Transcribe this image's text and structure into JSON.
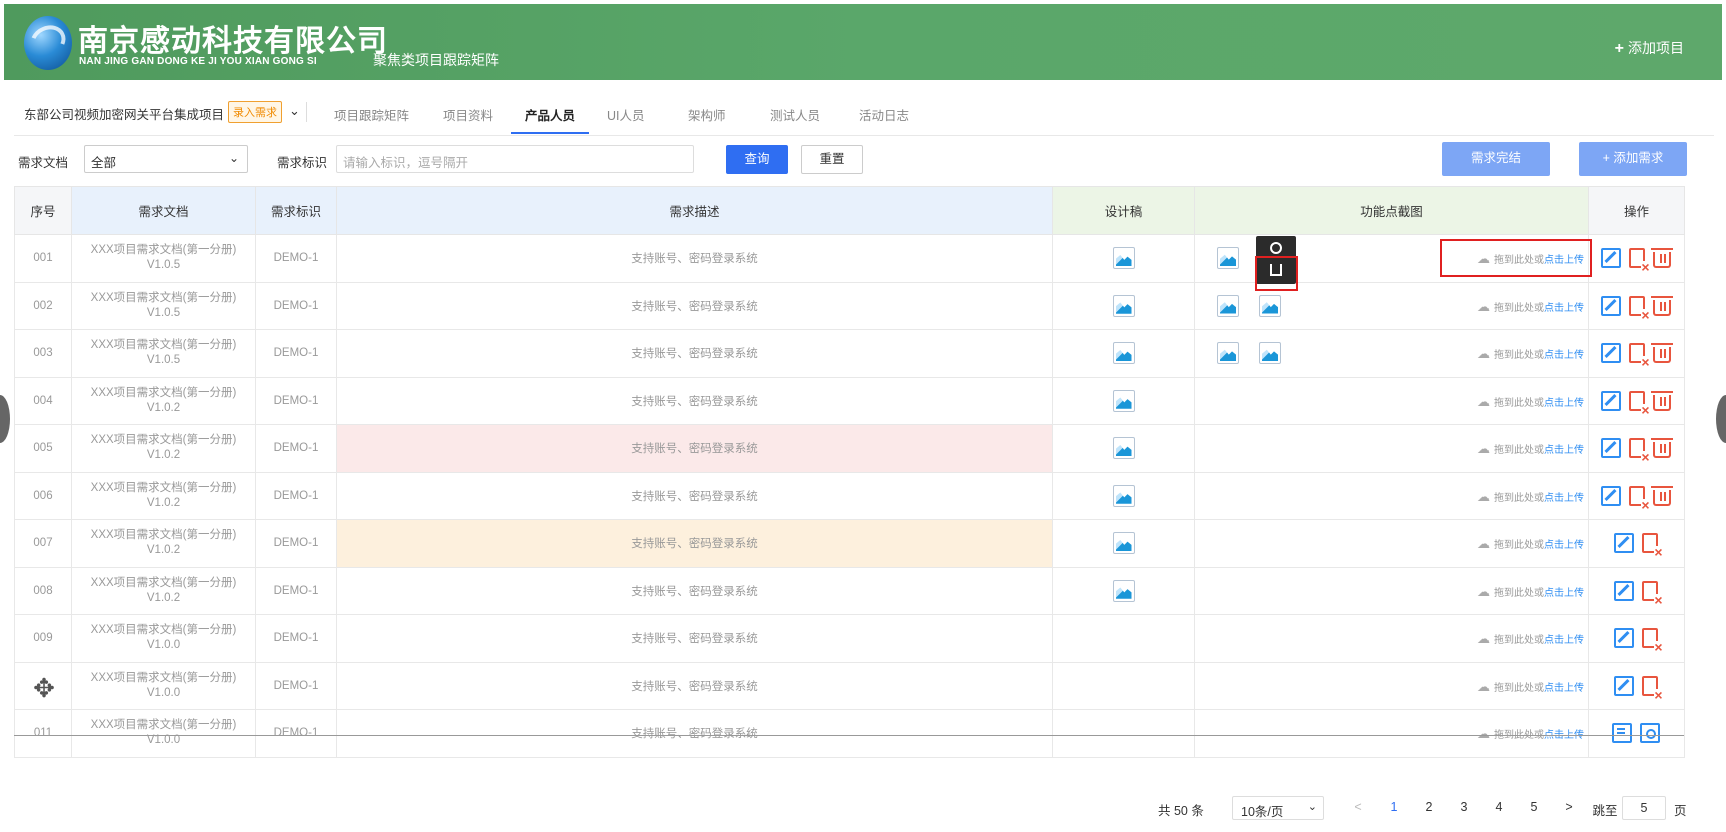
{
  "header": {
    "company_cn": "南京感动科技有限公司",
    "company_en": "NAN JING GAN DONG KE JI YOU XIAN GONG SI",
    "subtitle": "聚焦类项目跟踪矩阵",
    "add_project": "添加项目",
    "bg_color": "#5aa76a"
  },
  "nav": {
    "project_title": "东部公司视频加密网关平台集成项目",
    "tag": "录入需求",
    "tabs": [
      {
        "label": "项目跟踪矩阵"
      },
      {
        "label": "项目资料"
      },
      {
        "label": "产品人员"
      },
      {
        "label": "UI人员"
      },
      {
        "label": "架构师"
      },
      {
        "label": "测试人员"
      },
      {
        "label": "活动日志"
      }
    ],
    "active_tab": "产品人员"
  },
  "filter": {
    "doc_label": "需求文档",
    "doc_value": "全部",
    "id_label": "需求标识",
    "id_placeholder": "请输入标识，逗号隔开",
    "query": "查询",
    "reset": "重置",
    "complete": "需求完结",
    "add": "+ 添加需求"
  },
  "table": {
    "headers": {
      "seq": "序号",
      "doc": "需求文档",
      "id": "需求标识",
      "desc": "需求描述",
      "design": "设计稿",
      "func": "功能点截图",
      "ops": "操作"
    },
    "upload_text": "拖到此处或",
    "upload_link": "点击上传",
    "rows": [
      {
        "seq": "001",
        "doc1": "XXX项目需求文档(第一分册)",
        "doc2": "V1.0.5",
        "id": "DEMO-1",
        "desc": "支持账号、密码登录系统"
      },
      {
        "seq": "002",
        "doc1": "XXX项目需求文档(第一分册)",
        "doc2": "V1.0.5",
        "id": "DEMO-1",
        "desc": "支持账号、密码登录系统"
      },
      {
        "seq": "003",
        "doc1": "XXX项目需求文档(第一分册)",
        "doc2": "V1.0.5",
        "id": "DEMO-1",
        "desc": "支持账号、密码登录系统"
      },
      {
        "seq": "004",
        "doc1": "XXX项目需求文档(第一分册)",
        "doc2": "V1.0.2",
        "id": "DEMO-1",
        "desc": "支持账号、密码登录系统"
      },
      {
        "seq": "005",
        "doc1": "XXX项目需求文档(第一分册)",
        "doc2": "V1.0.2",
        "id": "DEMO-1",
        "desc": "支持账号、密码登录系统"
      },
      {
        "seq": "006",
        "doc1": "XXX项目需求文档(第一分册)",
        "doc2": "V1.0.2",
        "id": "DEMO-1",
        "desc": "支持账号、密码登录系统"
      },
      {
        "seq": "007",
        "doc1": "XXX项目需求文档(第一分册)",
        "doc2": "V1.0.2",
        "id": "DEMO-1",
        "desc": "支持账号、密码登录系统"
      },
      {
        "seq": "008",
        "doc1": "XXX项目需求文档(第一分册)",
        "doc2": "V1.0.2",
        "id": "DEMO-1",
        "desc": "支持账号、密码登录系统"
      },
      {
        "seq": "009",
        "doc1": "XXX项目需求文档(第一分册)",
        "doc2": "V1.0.0",
        "id": "DEMO-1",
        "desc": "支持账号、密码登录系统"
      },
      {
        "seq": "",
        "doc1": "XXX项目需求文档(第一分册)",
        "doc2": "V1.0.0",
        "id": "DEMO-1",
        "desc": "支持账号、密码登录系统"
      },
      {
        "seq": "011",
        "doc1": "XXX项目需求文档(第一分册)",
        "doc2": "V1.0.0",
        "id": "DEMO-1",
        "desc": "支持账号、密码登录系统"
      }
    ]
  },
  "pagination": {
    "total": "共 50 条",
    "page_size": "10条/页",
    "prev": "<",
    "pages": [
      "1",
      "2",
      "3",
      "4",
      "5"
    ],
    "current": "1",
    "next": ">",
    "jump_label": "跳至",
    "jump_value": "5",
    "jump_unit": "页"
  }
}
